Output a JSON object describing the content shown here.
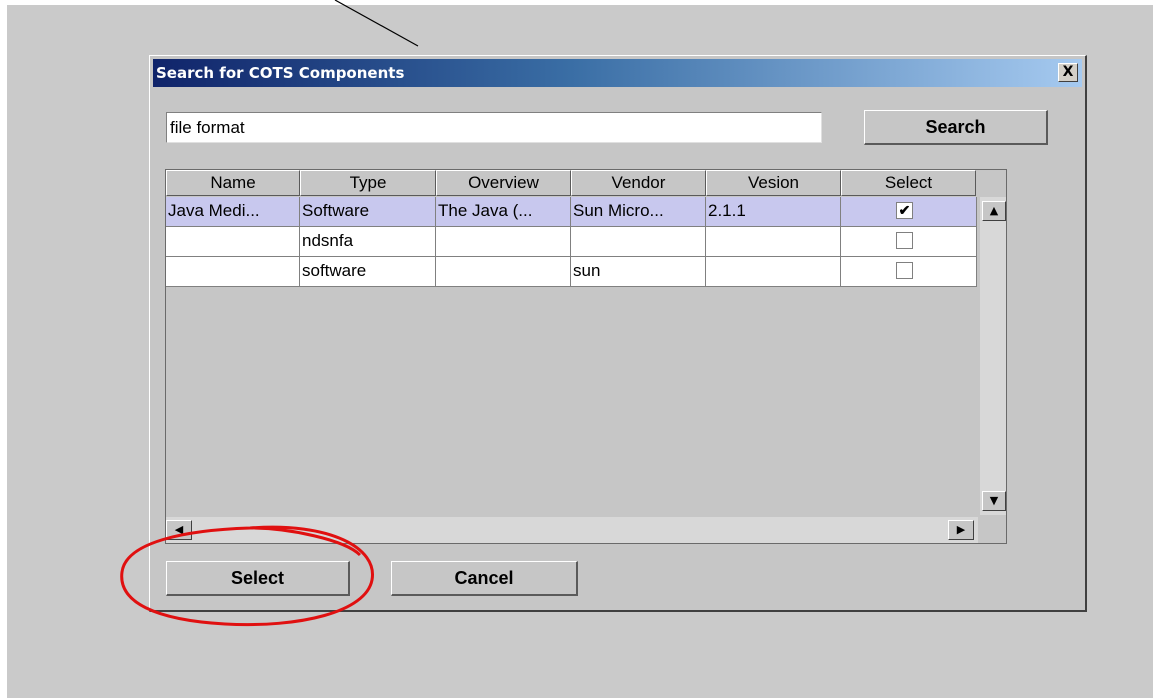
{
  "dialog": {
    "title": "Search for COTS Components",
    "close_label": "X"
  },
  "search": {
    "value": "file format",
    "button_label": "Search"
  },
  "table": {
    "columns": [
      "Name",
      "Type",
      "Overview",
      "Vendor",
      "Vesion",
      "Select"
    ],
    "rows": [
      {
        "name": "Java Medi...",
        "type": "Software",
        "overview": "The Java (...",
        "vendor": "Sun Micro...",
        "version": "2.1.1",
        "selected": true
      },
      {
        "name": "",
        "type": "ndsnfa",
        "overview": "",
        "vendor": "",
        "version": "",
        "selected": false
      },
      {
        "name": "",
        "type": "software",
        "overview": "",
        "vendor": "sun",
        "version": "",
        "selected": false
      }
    ]
  },
  "footer": {
    "select_label": "Select",
    "cancel_label": "Cancel"
  },
  "colors": {
    "selected_row": "#c8c8ee",
    "annotation": "#e01010",
    "title_start": "#10246a",
    "title_end": "#a6caf0"
  },
  "icons": {
    "checkbox_checked": "check-mark",
    "scroll_up": "triangle-up",
    "scroll_down": "triangle-down",
    "scroll_left": "triangle-left",
    "scroll_right": "triangle-right"
  }
}
